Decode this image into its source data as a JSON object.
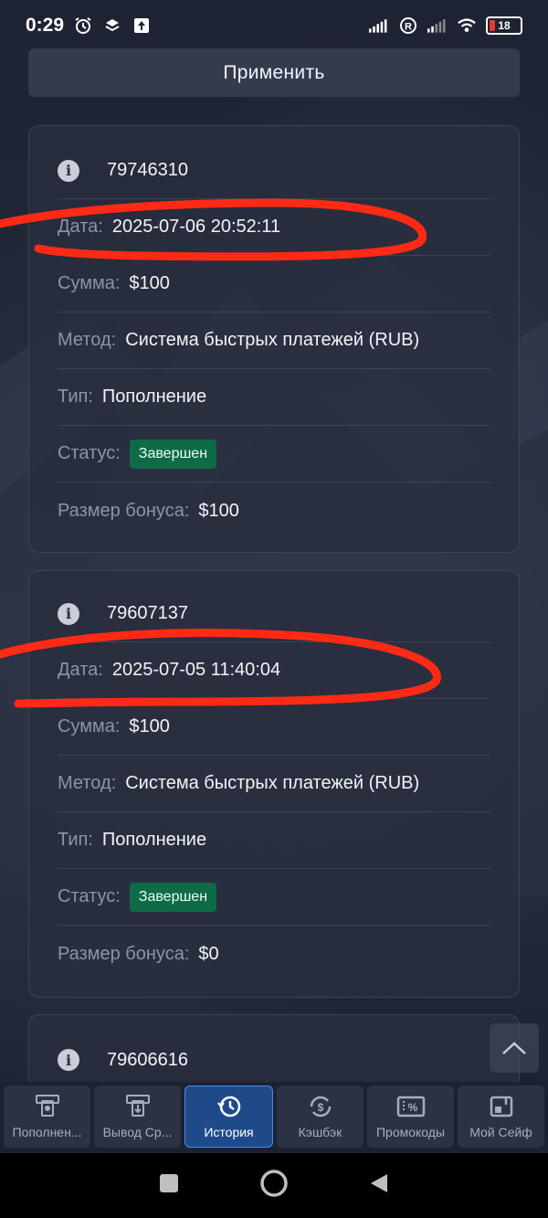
{
  "status_bar": {
    "time": "0:29",
    "battery": "18"
  },
  "filter": {
    "apply_label": "Применить"
  },
  "transactions": [
    {
      "id": "79746310",
      "date_label": "Дата:",
      "date": "2025-07-06 20:52:11",
      "amount_label": "Сумма:",
      "amount": "$100",
      "method_label": "Метод:",
      "method": "Система быстрых платежей (RUB)",
      "type_label": "Тип:",
      "type": "Пополнение",
      "status_label": "Статус:",
      "status": "Завершен",
      "bonus_label": "Размер бонуса:",
      "bonus": "$100"
    },
    {
      "id": "79607137",
      "date_label": "Дата:",
      "date": "2025-07-05 11:40:04",
      "amount_label": "Сумма:",
      "amount": "$100",
      "method_label": "Метод:",
      "method": "Система быстрых платежей (RUB)",
      "type_label": "Тип:",
      "type": "Пополнение",
      "status_label": "Статус:",
      "status": "Завершен",
      "bonus_label": "Размер бонуса:",
      "bonus": "$0"
    },
    {
      "id": "79606616"
    }
  ],
  "tabs": [
    {
      "label": "Пополнен...",
      "icon": "deposit-icon",
      "active": false
    },
    {
      "label": "Вывод Ср...",
      "icon": "withdraw-icon",
      "active": false
    },
    {
      "label": "История",
      "icon": "history-icon",
      "active": true
    },
    {
      "label": "Кэшбэк",
      "icon": "cashback-icon",
      "active": false
    },
    {
      "label": "Промокоды",
      "icon": "promo-icon",
      "active": false
    },
    {
      "label": "Мой Сейф",
      "icon": "safe-icon",
      "active": false
    }
  ],
  "colors": {
    "status_completed": "#0e6b45",
    "active_tab": "#1f4a8a",
    "highlight_marker": "#ff2a14"
  }
}
